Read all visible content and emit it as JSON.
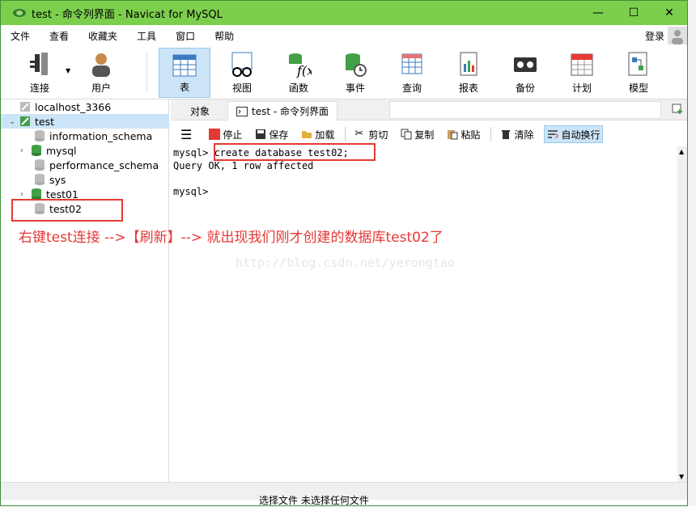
{
  "window": {
    "title": "test - 命令列界面 - Navicat for MySQL",
    "min": "—",
    "max": "☐",
    "close": "✕"
  },
  "menu": {
    "items": [
      "文件",
      "查看",
      "收藏夹",
      "工具",
      "窗口",
      "帮助"
    ],
    "login": "登录"
  },
  "toolbar": [
    {
      "label": "连接",
      "icon": "plug-icon"
    },
    {
      "label": "用户",
      "icon": "user-icon"
    },
    {
      "label": "表",
      "icon": "table-icon"
    },
    {
      "label": "视图",
      "icon": "view-icon"
    },
    {
      "label": "函数",
      "icon": "function-icon"
    },
    {
      "label": "事件",
      "icon": "event-icon"
    },
    {
      "label": "查询",
      "icon": "query-icon"
    },
    {
      "label": "报表",
      "icon": "report-icon"
    },
    {
      "label": "备份",
      "icon": "backup-icon"
    },
    {
      "label": "计划",
      "icon": "calendar-icon"
    },
    {
      "label": "模型",
      "icon": "model-icon"
    }
  ],
  "tree": {
    "connection": "localhost_3366",
    "db": "test",
    "children": [
      "information_schema",
      "mysql",
      "performance_schema",
      "sys",
      "test01",
      "test02"
    ]
  },
  "tabs": {
    "objects": "对象",
    "console": "test - 命令列界面"
  },
  "consoleToolbar": {
    "stop": "停止",
    "save": "保存",
    "load": "加载",
    "cut": "剪切",
    "copy": "复制",
    "paste": "粘贴",
    "clear": "清除",
    "wrap": "自动换行"
  },
  "console": {
    "line1_prompt": "mysql> ",
    "line1_cmd": "create database test02;",
    "line2": "Query OK, 1 row affected",
    "line4": "mysql> "
  },
  "annotation": "右键test连接 -->【刷新】--> 就出现我们刚才创建的数据库test02了",
  "watermark": "http://blog.csdn.net/yerongtao",
  "bottomText": "选择文件  未选择任何文件",
  "colors": {
    "titlebar": "#7ccf4d",
    "accent": "#cce4f7",
    "annotationRed": "#e53935"
  }
}
